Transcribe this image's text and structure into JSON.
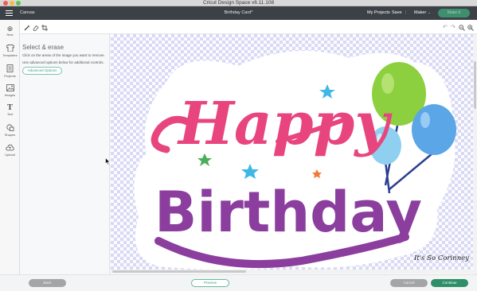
{
  "window": {
    "title": "Cricut Design Space  v6.11.108"
  },
  "header": {
    "section": "Canvas",
    "project_name": "Birthday Card*",
    "my_projects": "My Projects",
    "save": "Save",
    "separator": "|",
    "machine": "Maker",
    "make_it": "Make It"
  },
  "sidebar": {
    "items": [
      {
        "label": "New",
        "icon": "plus-circle-icon"
      },
      {
        "label": "Templates",
        "icon": "shirt-icon"
      },
      {
        "label": "Projects",
        "icon": "projects-icon"
      },
      {
        "label": "Images",
        "icon": "image-icon"
      },
      {
        "label": "Text",
        "icon": "text-icon"
      },
      {
        "label": "Shapes",
        "icon": "shapes-icon"
      },
      {
        "label": "Upload",
        "icon": "upload-cloud-icon"
      }
    ]
  },
  "toolbar": {
    "tools": [
      "wand-tool-icon",
      "eraser-tool-icon",
      "crop-tool-icon"
    ],
    "right_tools": [
      "undo-icon",
      "redo-icon",
      "zoom-out-icon",
      "zoom-in-icon"
    ]
  },
  "panel": {
    "title": "Select & erase",
    "instruction1": "Click on the areas of the image you want to remove.",
    "instruction2": "Use advanced options below for additional controls.",
    "advanced_button": "Advanced Options"
  },
  "canvas": {
    "image_text_line1": "Happy",
    "image_text_line2": "Birthday",
    "watermark": "It's So Corinney",
    "colors": {
      "happy": "#e8457e",
      "birthday": "#8b3e9e",
      "balloon_green": "#8ccf3f",
      "balloon_blue": "#5aa6e6",
      "balloon_lightblue": "#8fd0f0"
    }
  },
  "footer": {
    "back": "Back",
    "preview": "Preview",
    "cancel": "Cancel",
    "continue": "Continue"
  }
}
